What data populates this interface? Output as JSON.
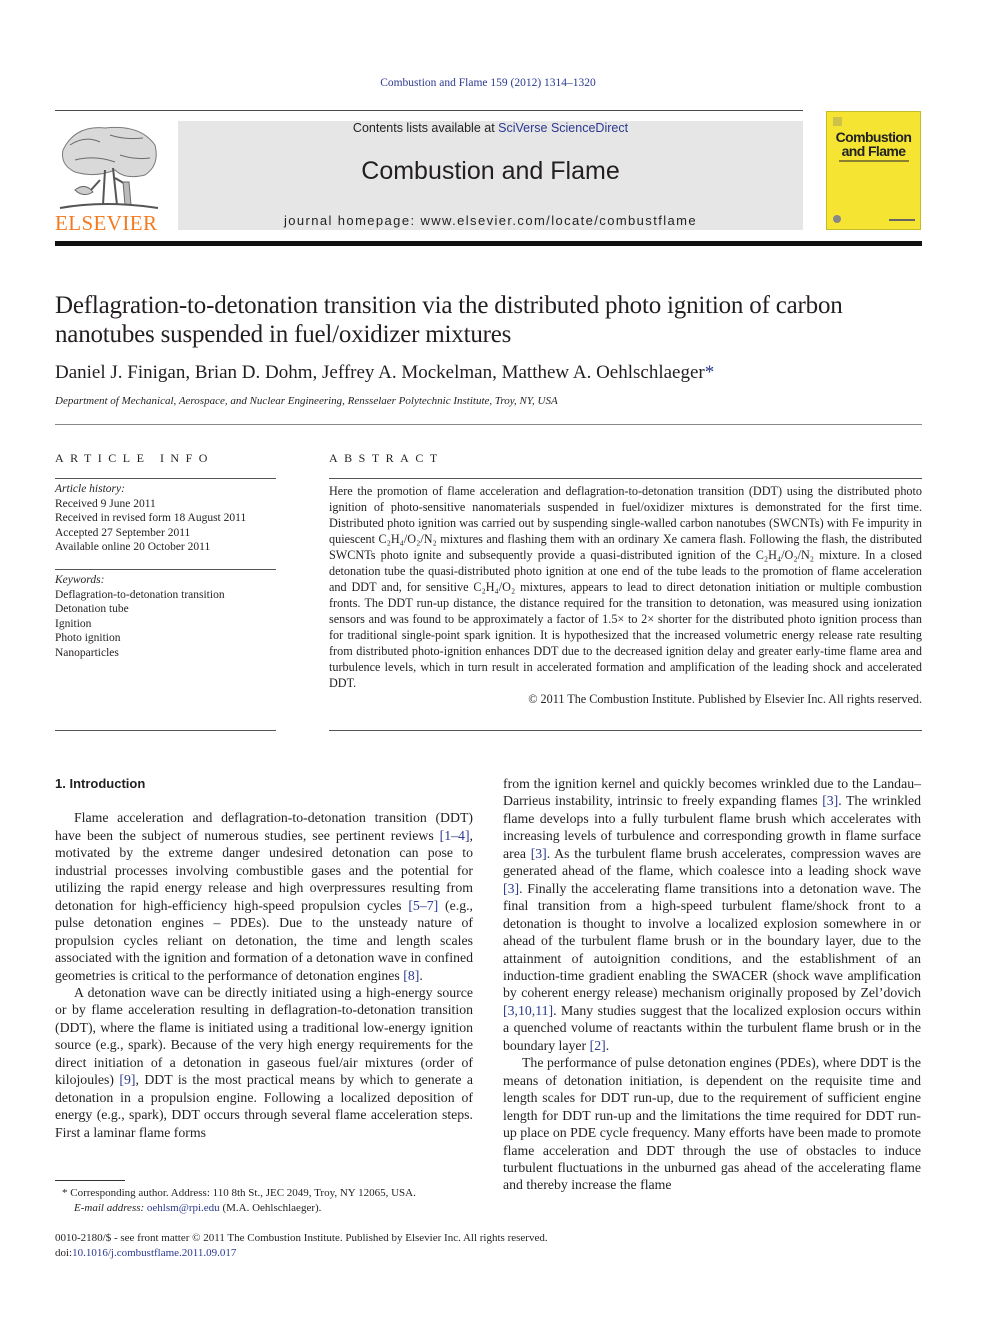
{
  "header": {
    "citation": "Combustion and Flame 159 (2012) 1314–1320",
    "contents_prefix": "Contents lists available at ",
    "contents_link": "SciVerse ScienceDirect",
    "journal_title": "Combustion and Flame",
    "homepage_prefix": "journal homepage: ",
    "homepage_url": "www.elsevier.com/locate/combustflame",
    "publisher_logo": "ELSEVIER",
    "cover_title_line1": "Combustion",
    "cover_title_line2": "and Flame",
    "colors": {
      "publisher_orange": "#f47a20",
      "cover_yellow": "#f5e532",
      "link_blue": "#2b3990",
      "banner_gray": "#e6e6e7"
    }
  },
  "article": {
    "title": "Deflagration-to-detonation transition via the distributed photo ignition of carbon nanotubes suspended in fuel/oxidizer mixtures",
    "authors": "Daniel J. Finigan, Brian D. Dohm, Jeffrey A. Mockelman, Matthew A. Oehlschlaeger",
    "corresponding_marker": "*",
    "affiliation": "Department of Mechanical, Aerospace, and Nuclear Engineering, Rensselaer Polytechnic Institute, Troy, NY, USA"
  },
  "article_info": {
    "heading": "ARTICLE INFO",
    "history_label": "Article history:",
    "history": [
      "Received 9 June 2011",
      "Received in revised form 18 August 2011",
      "Accepted 27 September 2011",
      "Available online 20 October 2011"
    ],
    "keywords_label": "Keywords:",
    "keywords": [
      "Deflagration-to-detonation transition",
      "Detonation tube",
      "Ignition",
      "Photo ignition",
      "Nanoparticles"
    ]
  },
  "abstract": {
    "heading": "ABSTRACT",
    "text": "Here the promotion of flame acceleration and deflagration-to-detonation transition (DDT) using the distributed photo ignition of photo-sensitive nanomaterials suspended in fuel/oxidizer mixtures is demonstrated for the first time. Distributed photo ignition was carried out by suspending single-walled carbon nanotubes (SWCNTs) with Fe impurity in quiescent C₂H₄/O₂/N₂ mixtures and flashing them with an ordinary Xe camera flash. Following the flash, the distributed SWCNTs photo ignite and subsequently provide a quasi-distributed ignition of the C₂H₄/O₂/N₂ mixture. In a closed detonation tube the quasi-distributed photo ignition at one end of the tube leads to the promotion of flame acceleration and DDT and, for sensitive C₂H₄/O₂ mixtures, appears to lead to direct detonation initiation or multiple combustion fronts. The DDT run-up distance, the distance required for the transition to detonation, was measured using ionization sensors and was found to be approximately a factor of 1.5× to 2× shorter for the distributed photo ignition process than for traditional single-point spark ignition. It is hypothesized that the increased volumetric energy release rate resulting from distributed photo-ignition enhances DDT due to the decreased ignition delay and greater early-time flame area and turbulence levels, which in turn result in accelerated formation and amplification of the leading shock and accelerated DDT.",
    "copyright": "© 2011 The Combustion Institute. Published by Elsevier Inc. All rights reserved."
  },
  "body": {
    "section_heading": "1. Introduction",
    "left": {
      "p1_a": "Flame acceleration and deflagration-to-detonation transition (DDT) have been the subject of numerous studies, see pertinent reviews ",
      "p1_ref1": "[1–4]",
      "p1_b": ", motivated by the extreme danger undesired detonation can pose to industrial processes involving combustible gases and the potential for utilizing the rapid energy release and high overpressures resulting from detonation for high-efficiency high-speed propulsion cycles ",
      "p1_ref2": "[5–7]",
      "p1_c": " (e.g., pulse detonation engines – PDEs). Due to the unsteady nature of propulsion cycles reliant on detonation, the time and length scales associated with the ignition and formation of a detonation wave in confined geometries is critical to the performance of detonation engines ",
      "p1_ref3": "[8]",
      "p1_d": ".",
      "p2_a": "A detonation wave can be directly initiated using a high-energy source or by flame acceleration resulting in deflagration-to-detonation transition (DDT), where the flame is initiated using a traditional low-energy ignition source (e.g., spark). Because of the very high energy requirements for the direct initiation of a detonation in gaseous fuel/air mixtures (order of kilojoules) ",
      "p2_ref1": "[9]",
      "p2_b": ", DDT is the most practical means by which to generate a detonation in a propulsion engine. Following a localized deposition of energy (e.g., spark), DDT occurs through several flame acceleration steps. First a laminar flame forms"
    },
    "right": {
      "p1_a": "from the ignition kernel and quickly becomes wrinkled due to the Landau–Darrieus instability, intrinsic to freely expanding flames ",
      "p1_ref1": "[3]",
      "p1_b": ". The wrinkled flame develops into a fully turbulent flame brush which accelerates with increasing levels of turbulence and corresponding growth in flame surface area ",
      "p1_ref2": "[3]",
      "p1_c": ". As the turbulent flame brush accelerates, compression waves are generated ahead of the flame, which coalesce into a leading shock wave ",
      "p1_ref3": "[3]",
      "p1_d": ". Finally the accelerating flame transitions into a detonation wave. The final transition from a high-speed turbulent flame/shock front to a detonation is thought to involve a localized explosion somewhere in or ahead of the turbulent flame brush or in the boundary layer, due to the attainment of autoignition conditions, and the establishment of an induction-time gradient enabling the SWACER (shock wave amplification by coherent energy release) mechanism originally proposed by Zel’dovich ",
      "p1_ref4": "[3,10,11]",
      "p1_e": ". Many studies suggest that the localized explosion occurs within a quenched volume of reactants within the turbulent flame brush or in the boundary layer ",
      "p1_ref5": "[2]",
      "p1_f": ".",
      "p2": "The performance of pulse detonation engines (PDEs), where DDT is the means of detonation initiation, is dependent on the requisite time and length scales for DDT run-up, due to the requirement of sufficient engine length for DDT run-up and the limitations the time required for DDT run-up place on PDE cycle frequency. Many efforts have been made to promote flame acceleration and DDT through the use of obstacles to induce turbulent fluctuations in the unburned gas ahead of the accelerating flame and thereby increase the flame"
    }
  },
  "footnote": {
    "marker": "*",
    "text": " Corresponding author. Address: 110 8th St., JEC 2049, Troy, NY 12065, USA.",
    "email_label": "E-mail address: ",
    "email": "oehlsm@rpi.edu",
    "email_suffix": " (M.A. Oehlschlaeger)."
  },
  "front_matter": {
    "issn_line": "0010-2180/$ - see front matter © 2011 The Combustion Institute. Published by Elsevier Inc. All rights reserved.",
    "doi_label": "doi:",
    "doi": "10.1016/j.combustflame.2011.09.017"
  }
}
